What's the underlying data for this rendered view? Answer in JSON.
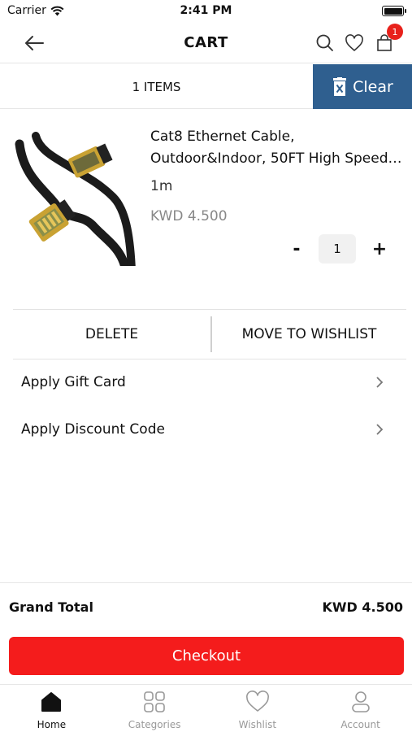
{
  "status_bar": {
    "carrier": "Carrier",
    "time": "2:41 PM"
  },
  "header": {
    "title": "CART",
    "cart_badge": "1"
  },
  "items_bar": {
    "count_label": "1 ITEMS",
    "clear_label": "Clear"
  },
  "product": {
    "name_line1": "Cat8 Ethernet Cable,",
    "name_line2": "Outdoor&Indoor, 50FT High Speed…",
    "variant": "1m",
    "price": "KWD 4.500",
    "quantity": "1",
    "minus": "-",
    "plus": "+"
  },
  "actions": {
    "delete_label": "DELETE",
    "wishlist_label": "MOVE TO WISHLIST"
  },
  "apply": {
    "gift_card": "Apply Gift Card",
    "discount_code": "Apply Discount Code"
  },
  "summary": {
    "grand_total_label": "Grand Total",
    "grand_total_value": "KWD 4.500",
    "checkout_label": "Checkout"
  },
  "tabs": [
    {
      "label": "Home",
      "icon": "home-icon",
      "active": true
    },
    {
      "label": "Categories",
      "icon": "categories-icon",
      "active": false
    },
    {
      "label": "Wishlist",
      "icon": "heart-icon",
      "active": false
    },
    {
      "label": "Account",
      "icon": "account-icon",
      "active": false
    }
  ],
  "colors": {
    "clear_bg": "#2f5f8f",
    "checkout_bg": "#f41c1c",
    "badge": "#e8211b"
  }
}
